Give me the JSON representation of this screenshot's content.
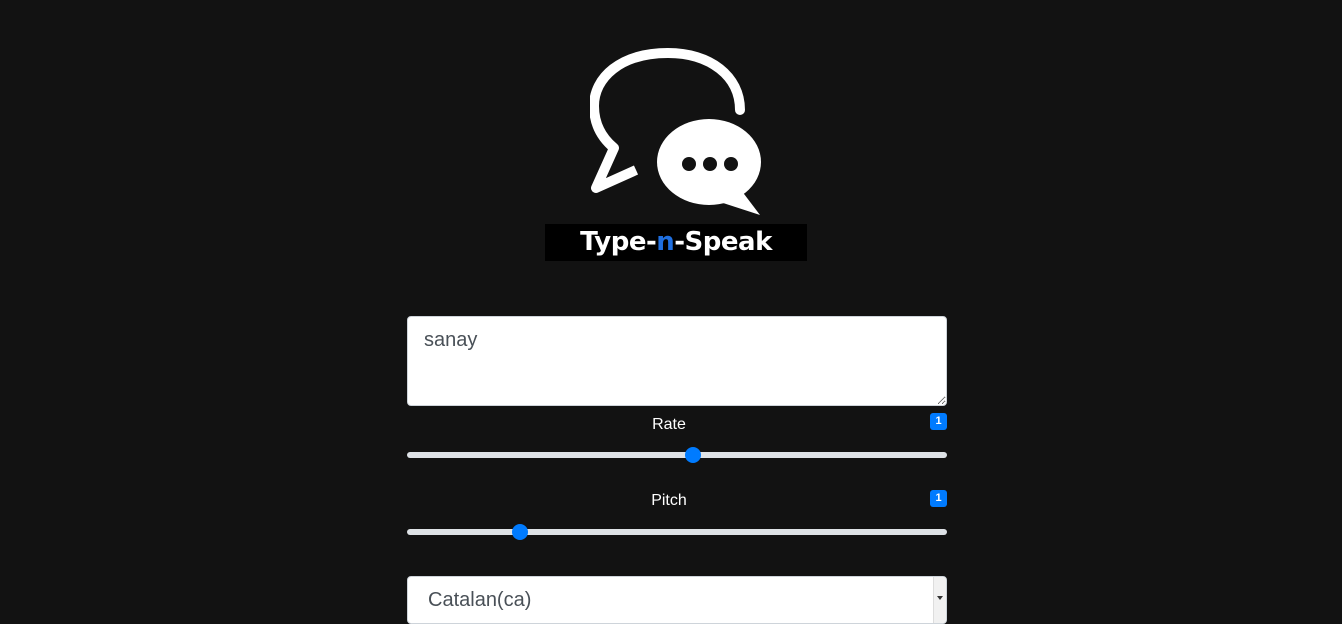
{
  "brand": {
    "name_prefix": "Type-",
    "name_accent": "n",
    "name_suffix": "-Speak",
    "logo_icon": "chat-bubbles-icon",
    "accent_color": "#1f6fe0"
  },
  "text_input": {
    "value": "sanay"
  },
  "rate": {
    "label": "Rate",
    "badge": "1",
    "fraction": 0.53
  },
  "pitch": {
    "label": "Pitch",
    "badge": "1",
    "fraction": 0.21
  },
  "voice_select": {
    "selected": "Catalan(ca)"
  },
  "colors": {
    "background": "#121212",
    "slider_accent": "#007bff"
  }
}
